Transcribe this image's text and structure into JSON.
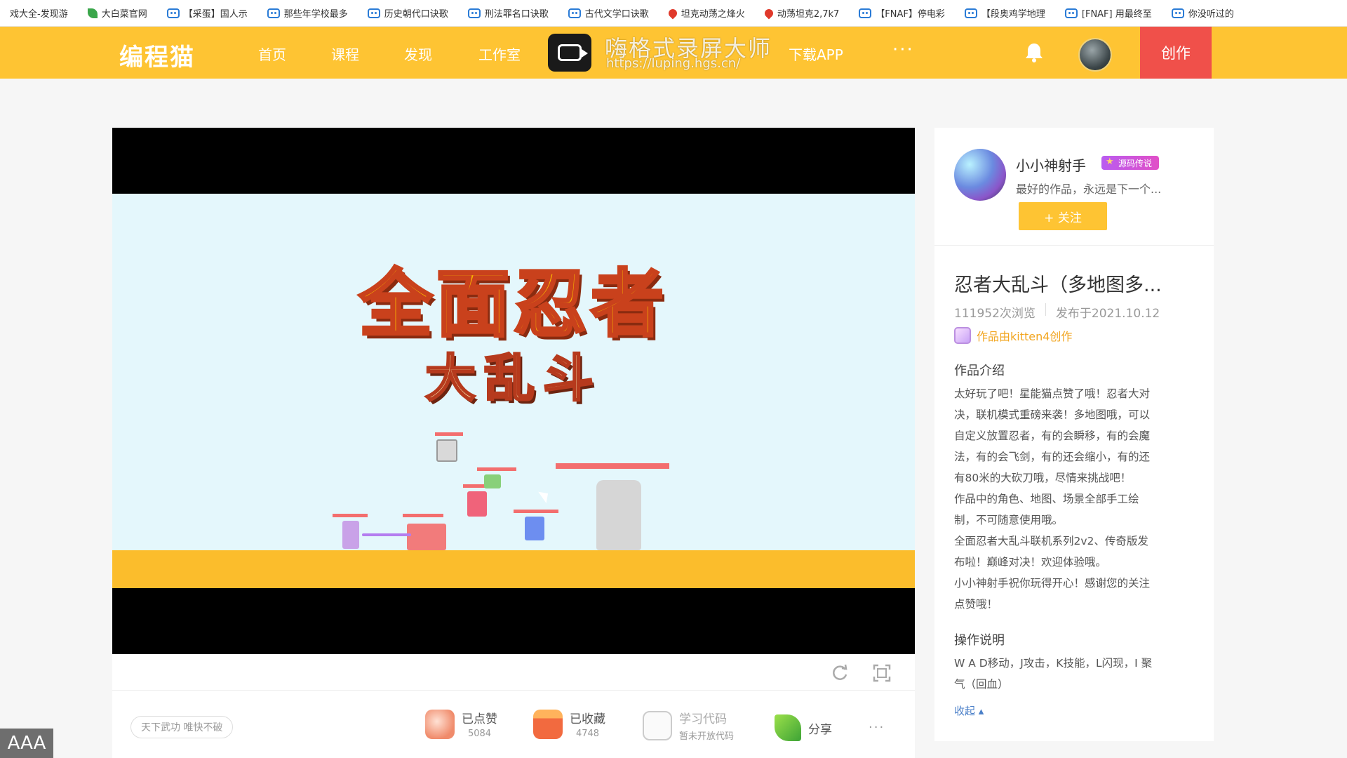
{
  "bookmarks": [
    {
      "label": "戏大全-发现游",
      "icon": "page-icon"
    },
    {
      "label": "大白菜官网",
      "icon": "leaf-icon"
    },
    {
      "label": "【采蛋】国人示",
      "icon": "tv-icon"
    },
    {
      "label": "那些年学校最多",
      "icon": "tv-icon"
    },
    {
      "label": "历史朝代口诀歌",
      "icon": "tv-icon"
    },
    {
      "label": "刑法罪名口诀歌",
      "icon": "tv-icon"
    },
    {
      "label": "古代文学口诀歌",
      "icon": "tv-icon"
    },
    {
      "label": "坦克动荡之烽火",
      "icon": "pin-icon"
    },
    {
      "label": "动荡坦克2,7k7",
      "icon": "pin-icon"
    },
    {
      "label": "【FNAF】停电彩",
      "icon": "tv-icon"
    },
    {
      "label": "【段奥鸡学地理",
      "icon": "tv-icon"
    },
    {
      "label": "[FNAF] 用最终至",
      "icon": "tv-icon"
    },
    {
      "label": "你没听过的",
      "icon": "tv-icon"
    }
  ],
  "nav": {
    "logo": "编程猫",
    "items": [
      "首页",
      "课程",
      "发现",
      "工作室",
      "下载APP"
    ],
    "more": "···",
    "create": "创作",
    "accent": "#fec433",
    "create_color": "#f0504a"
  },
  "recorder": {
    "title": "嗨格式录屏大师",
    "url": "https://luping.hgs.cn/"
  },
  "video": {
    "title_line1": "全面忍者",
    "title_line2": "大乱斗"
  },
  "actions": {
    "tagline": "天下武功 唯快不破",
    "like_label": "已点赞",
    "like_count": "5084",
    "fav_label": "已收藏",
    "fav_count": "4748",
    "code_label": "学习代码",
    "code_sub": "暂未开放代码",
    "share_label": "分享",
    "more": "···"
  },
  "author": {
    "name": "小小神射手",
    "badge": "源码传说",
    "motto": "最好的作品，永远是下一个...",
    "follow": "+ 关注"
  },
  "work": {
    "title": "忍者大乱斗（多地图多...",
    "views": "111952次浏览",
    "published": "发布于2021.10.12",
    "made_with": "作品由kitten4创作",
    "intro_heading": "作品介绍",
    "intro_lines": [
      "太好玩了吧！星能猫点赞了哦！忍者大对",
      "决，联机模式重磅来袭！多地图哦，可以",
      "自定义放置忍者，有的会瞬移，有的会魔",
      "法，有的会飞剑，有的还会缩小，有的还",
      "有80米的大砍刀哦，尽情来挑战吧！",
      "作品中的角色、地图、场景全部手工绘",
      "制，不可随意使用哦。",
      "全面忍者大乱斗联机系列2v2、传奇版发",
      "布啦！巅峰对决！欢迎体验哦。",
      "小小神射手祝你玩得开心！感谢您的关注",
      "点赞哦！"
    ],
    "ops_heading": "操作说明",
    "ops_lines": [
      "W A D移动，J攻击，K技能，L闪现，I 聚",
      "气（回血）"
    ],
    "collapse": "收起 ▴"
  },
  "overlay": {
    "aaa": "AAA"
  }
}
